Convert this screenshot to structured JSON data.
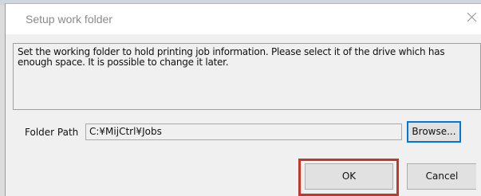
{
  "dialog": {
    "title": "Setup work folder",
    "close_icon": "close-icon",
    "description": "Set the working folder to hold printing job information. Please select it of the drive which has enough space. It is possible to change it later.",
    "folder_label": "Folder Path",
    "folder_path_value": "C:¥MijCtrl¥Jobs",
    "browse_label": "Browse...",
    "ok_label": "OK",
    "cancel_label": "Cancel"
  },
  "colors": {
    "highlight": "#c0392b",
    "focus": "#0078d7"
  }
}
